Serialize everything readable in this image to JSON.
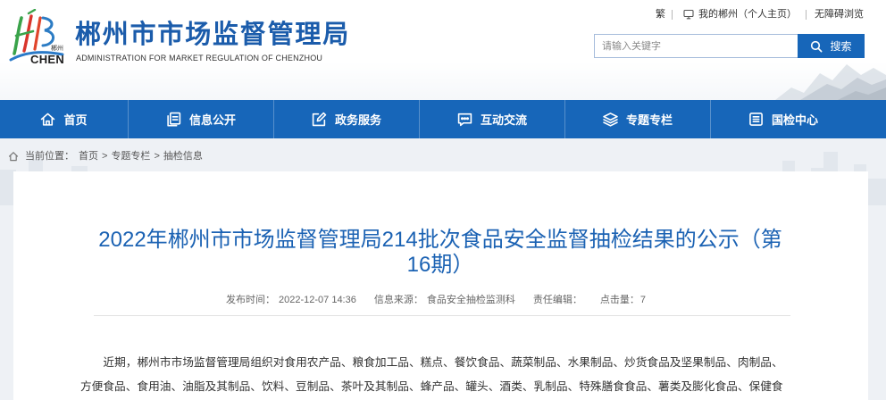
{
  "colors": {
    "nav_blue": "#1766b9",
    "brand_blue": "#1b5cab",
    "title_blue": "#1b62b3",
    "search_button_blue": "#1766b9"
  },
  "header": {
    "logo": {
      "icon": "chenzhou-logo-icon",
      "mark_cn": "郴州",
      "mark_en": "CHEN"
    },
    "site_title": "郴州市市场监督管理局",
    "site_subtitle": "ADMINISTRATION FOR MARKET REGULATION OF CHENZHOU",
    "top_links": {
      "traditional_chinese": "繁",
      "my_portal_icon": "monitor-icon",
      "my_portal": "我的郴州（个人主页）",
      "accessibility": "无障碍浏览"
    },
    "search": {
      "placeholder": "请输入关键字",
      "button_icon": "search-icon",
      "button_label": "搜索"
    }
  },
  "nav": {
    "items": [
      {
        "label": "首页",
        "icon": "home-icon"
      },
      {
        "label": "信息公开",
        "icon": "document-icon"
      },
      {
        "label": "政务服务",
        "icon": "edit-icon"
      },
      {
        "label": "互动交流",
        "icon": "chat-icon"
      },
      {
        "label": "专题专栏",
        "icon": "layers-icon"
      },
      {
        "label": "国检中心",
        "icon": "list-icon"
      }
    ]
  },
  "breadcrumb": {
    "icon": "home-icon",
    "prefix": "当前位置：",
    "separator": ">",
    "items": [
      "首页",
      "专题专栏",
      "抽检信息"
    ]
  },
  "article": {
    "title": "2022年郴州市市场监督管理局214批次食品安全监督抽检结果的公示（第16期）",
    "meta": {
      "publish_label": "发布时间：",
      "publish_time": "2022-12-07 14:36",
      "source_label": "信息来源：",
      "source": "食品安全抽检监测科",
      "editor_label": "责任编辑：",
      "views_label": "点击量：",
      "views": 7
    },
    "body": "近期，郴州市市场监督管理局组织对食用农产品、粮食加工品、糕点、餐饮食品、蔬菜制品、水果制品、炒货食品及坚果制品、肉制品、方便食品、食用油、油脂及其制品、饮料、豆制品、茶叶及其制品、蜂产品、罐头、酒类、乳制品、特殊膳食食品、薯类及膨化食品、保健食"
  }
}
